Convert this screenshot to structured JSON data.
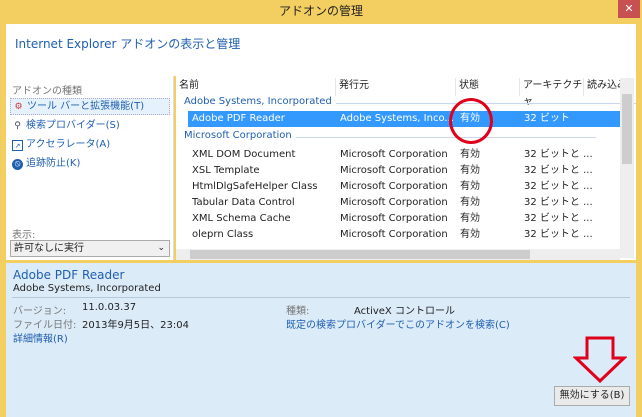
{
  "window": {
    "title": "アドオンの管理",
    "close": "✕"
  },
  "header": {
    "title": "Internet Explorer アドオンの表示と管理"
  },
  "sidebar": {
    "section_label": "アドオンの種類",
    "items": [
      {
        "label": "ツール バーと拡張機能(T)",
        "icon": "gear-icon"
      },
      {
        "label": "検索プロバイダー(S)",
        "icon": "search-icon"
      },
      {
        "label": "アクセラレータ(A)",
        "icon": "accelerator-icon"
      },
      {
        "label": "追跡防止(K)",
        "icon": "block-icon"
      }
    ],
    "show_label": "表示:",
    "show_value": "許可なしに実行"
  },
  "table": {
    "columns": [
      "名前",
      "発行元",
      "状態",
      "アーキテクチャ",
      "読み込み"
    ],
    "groups": [
      {
        "name": "Adobe Systems, Incorporated",
        "rows": [
          [
            "Adobe PDF Reader",
            "Adobe Systems, Inco...",
            "有効",
            "32 ビット"
          ]
        ]
      },
      {
        "name": "Microsoft Corporation",
        "rows": [
          [
            "XML DOM Document",
            "Microsoft Corporation",
            "有効",
            "32 ビットと ..."
          ],
          [
            "XSL Template",
            "Microsoft Corporation",
            "有効",
            "32 ビットと ..."
          ],
          [
            "HtmlDlgSafeHelper Class",
            "Microsoft Corporation",
            "有効",
            "32 ビットと ..."
          ],
          [
            "Tabular Data Control",
            "Microsoft Corporation",
            "有効",
            "32 ビットと ..."
          ],
          [
            "XML Schema Cache",
            "Microsoft Corporation",
            "有効",
            "32 ビットと ..."
          ],
          [
            "oleprn Class",
            "Microsoft Corporation",
            "有効",
            "32 ビットと ..."
          ]
        ]
      }
    ]
  },
  "details": {
    "name": "Adobe PDF Reader",
    "publisher": "Adobe Systems, Incorporated",
    "version_label": "バージョン:",
    "version": "11.0.03.37",
    "date_label": "ファイル日付:",
    "date": "2013年9月5日、23:04",
    "more_info": "詳細情報(R)",
    "type_label": "種類:",
    "type": "ActiveX コントロール",
    "search_link": "既定の検索プロバイダーでこのアドオンを検索(C)",
    "disable_button": "無効にする(B)"
  },
  "colors": {
    "accent": "#3399ff",
    "link": "#1f5fb0",
    "annotation": "#e0001b",
    "frame": "#f3cf62"
  }
}
